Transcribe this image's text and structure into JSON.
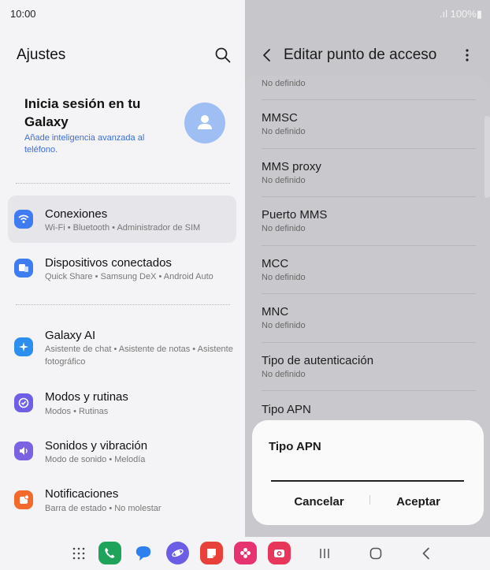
{
  "status_bar": {
    "time": "10:00",
    "battery": ".ıl 100%▮"
  },
  "left_pane": {
    "title": "Ajustes",
    "account": {
      "title": "Inicia sesión en tu Galaxy",
      "subtitle": "Añade inteligencia avanzada al teléfono."
    },
    "items": [
      {
        "title": "Conexiones",
        "subtitle": "Wi-Fi • Bluetooth • Administrador de SIM",
        "color": "#3f7cf2"
      },
      {
        "title": "Dispositivos conectados",
        "subtitle": "Quick Share • Samsung DeX • Android Auto",
        "color": "#3f7cf2"
      },
      {
        "title": "Galaxy AI",
        "subtitle": "Asistente de chat • Asistente de notas • Asistente fotográfico",
        "color": "#2c8ff0"
      },
      {
        "title": "Modos y rutinas",
        "subtitle": "Modos • Rutinas",
        "color": "#6f5fe6"
      },
      {
        "title": "Sonidos y vibración",
        "subtitle": "Modo de sonido • Melodía",
        "color": "#7a62e3"
      },
      {
        "title": "Notificaciones",
        "subtitle": "Barra de estado • No molestar",
        "color": "#f26a2c"
      }
    ]
  },
  "right_pane": {
    "title": "Editar punto de acceso",
    "first_row_value": "No definido",
    "rows": [
      {
        "title": "MMSC",
        "value": "No definido"
      },
      {
        "title": "MMS proxy",
        "value": "No definido"
      },
      {
        "title": "Puerto MMS",
        "value": "No definido"
      },
      {
        "title": "MCC",
        "value": "No definido"
      },
      {
        "title": "MNC",
        "value": "No definido"
      },
      {
        "title": "Tipo de autenticación",
        "value": "No definido"
      },
      {
        "title": "Tipo APN",
        "value": ""
      }
    ]
  },
  "dialog": {
    "title": "Tipo APN",
    "input_value": "",
    "cancel": "Cancelar",
    "ok": "Aceptar"
  },
  "taskbar": {
    "apps": [
      {
        "icon": "apps-grid-icon"
      },
      {
        "icon": "phone-icon",
        "color": "#1fa35b"
      },
      {
        "icon": "messages-icon",
        "color": "#2f7ff0"
      },
      {
        "icon": "browser-icon",
        "color": "#6b5de6"
      },
      {
        "icon": "notes-icon",
        "color": "#e8413a"
      },
      {
        "icon": "gallery-icon",
        "color": "#e6336f"
      },
      {
        "icon": "camera-icon",
        "color": "#e8355a"
      }
    ]
  }
}
